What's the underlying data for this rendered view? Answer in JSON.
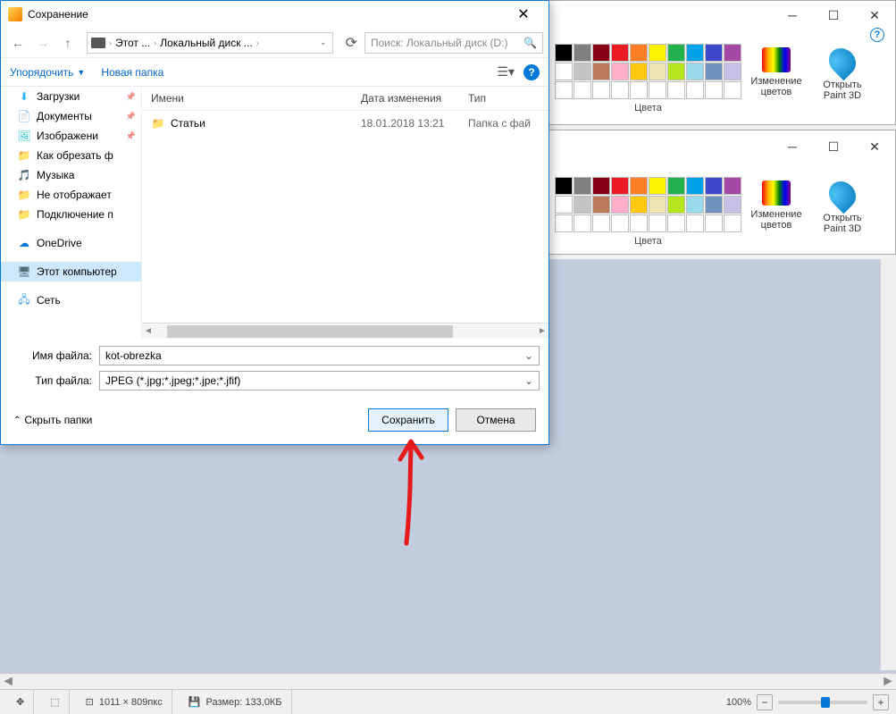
{
  "dialog": {
    "title": "Сохранение",
    "nav": {
      "crumb1": "Этот ...",
      "crumb2": "Локальный диск ...",
      "search_placeholder": "Поиск: Локальный диск (D:)"
    },
    "toolbar": {
      "organize": "Упорядочить",
      "new_folder": "Новая папка"
    },
    "tree": [
      {
        "label": "Загрузки",
        "icon": "dl",
        "pin": true
      },
      {
        "label": "Документы",
        "icon": "doc",
        "pin": true
      },
      {
        "label": "Изображени",
        "icon": "img",
        "pin": true
      },
      {
        "label": "Как обрезать ф",
        "icon": "fold"
      },
      {
        "label": "Музыка",
        "icon": "mus"
      },
      {
        "label": "Не отображает",
        "icon": "fold"
      },
      {
        "label": "Подключение п",
        "icon": "fold"
      },
      {
        "label": "OneDrive",
        "icon": "cloud",
        "gap": true
      },
      {
        "label": "Этот компьютер",
        "icon": "pc",
        "sel": true,
        "gap": true
      },
      {
        "label": "Сеть",
        "icon": "net",
        "gap": true
      }
    ],
    "columns": {
      "name": "Имени",
      "date": "Дата изменения",
      "type": "Тип"
    },
    "rows": [
      {
        "name": "Статьи",
        "date": "18.01.2018 13:21",
        "type": "Папка с фай"
      }
    ],
    "filename_label": "Имя файла:",
    "filename_value": "kot-obrezka",
    "filetype_label": "Тип файла:",
    "filetype_value": "JPEG (*.jpg;*.jpeg;*.jpe;*.jfif)",
    "hide_folders": "Скрыть папки",
    "save": "Сохранить",
    "cancel": "Отмена"
  },
  "ribbon": {
    "colors_label": "Цвета",
    "edit_colors": "Изменение цветов",
    "paint3d": "Открыть Paint 3D",
    "palette": [
      "#000",
      "#7f7f7f",
      "#880015",
      "#ed1c24",
      "#ff7f27",
      "#fff200",
      "#22b14c",
      "#00a2e8",
      "#3f48cc",
      "#a349a4",
      "#fff",
      "#c3c3c3",
      "#b97a57",
      "#ffaec9",
      "#ffc90e",
      "#efe4b0",
      "#b5e61d",
      "#99d9ea",
      "#7092be",
      "#c8bfe7",
      "#fff",
      "#fff",
      "#fff",
      "#fff",
      "#fff",
      "#fff",
      "#fff",
      "#fff",
      "#fff",
      "#fff"
    ]
  },
  "status": {
    "dims": "1011 × 809пкс",
    "size": "Размер: 133,0КБ",
    "zoom": "100%"
  }
}
